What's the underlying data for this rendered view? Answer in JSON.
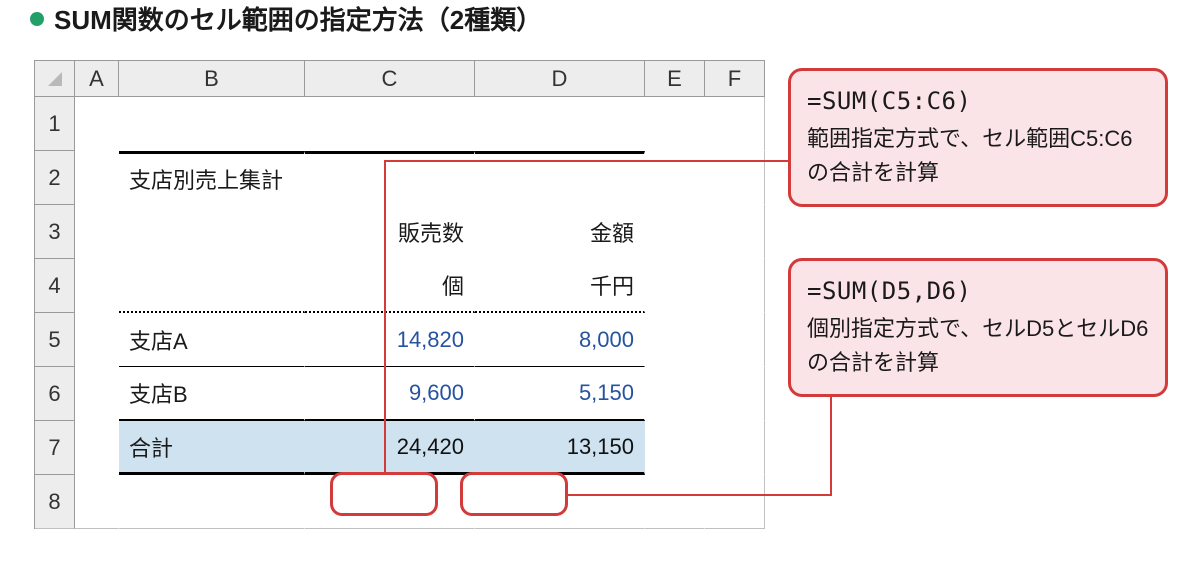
{
  "title": "SUM関数のセル範囲の指定方法（2種類）",
  "colHeaders": [
    "A",
    "B",
    "C",
    "D",
    "E",
    "F"
  ],
  "rowHeaders": [
    "1",
    "2",
    "3",
    "4",
    "5",
    "6",
    "7",
    "8"
  ],
  "cells": {
    "b2": "支店別売上集計",
    "c3": "販売数",
    "d3": "金額",
    "c4": "個",
    "d4": "千円",
    "b5": "支店A",
    "c5": "14,820",
    "d5": "8,000",
    "b6": "支店B",
    "c6": "9,600",
    "d6": "5,150",
    "b7": "合計",
    "c7": "24,420",
    "d7": "13,150"
  },
  "callout1": {
    "formula": "=SUM(C5:C6)",
    "desc": "範囲指定方式で、セル範囲C5:C6の合計を計算"
  },
  "callout2": {
    "formula": "=SUM(D5,D6)",
    "desc": "個別指定方式で、セルD5とセルD6の合計を計算"
  }
}
